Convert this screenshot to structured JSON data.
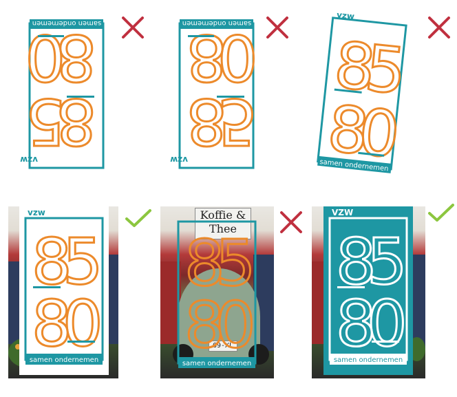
{
  "logo": {
    "org_label": "vzw",
    "org_label_caps": "VZW",
    "digits": [
      "8",
      "5",
      "8",
      "0"
    ],
    "tagline": "samen ondernemen"
  },
  "verdicts": [
    "cross",
    "cross",
    "cross",
    "check",
    "cross",
    "check"
  ],
  "photo_sign": "Koffie & Thee",
  "photo_plate": "69-XL",
  "colors": {
    "teal": "#1e97a3",
    "orange": "#ec8a2b",
    "cross": "#c0303f",
    "check": "#8cc63f"
  }
}
